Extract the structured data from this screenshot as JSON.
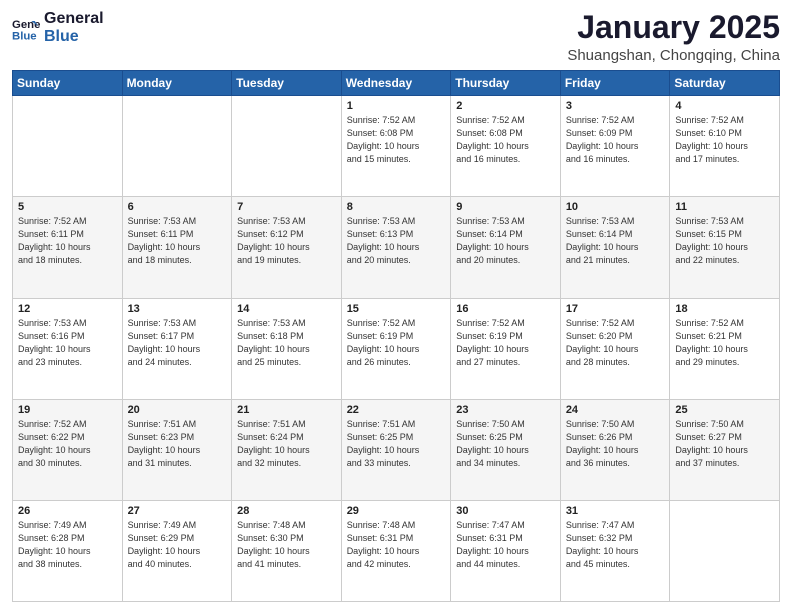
{
  "logo": {
    "line1": "General",
    "line2": "Blue"
  },
  "title": "January 2025",
  "subtitle": "Shuangshan, Chongqing, China",
  "days_header": [
    "Sunday",
    "Monday",
    "Tuesday",
    "Wednesday",
    "Thursday",
    "Friday",
    "Saturday"
  ],
  "weeks": [
    [
      {
        "day": "",
        "info": ""
      },
      {
        "day": "",
        "info": ""
      },
      {
        "day": "",
        "info": ""
      },
      {
        "day": "1",
        "info": "Sunrise: 7:52 AM\nSunset: 6:08 PM\nDaylight: 10 hours\nand 15 minutes."
      },
      {
        "day": "2",
        "info": "Sunrise: 7:52 AM\nSunset: 6:08 PM\nDaylight: 10 hours\nand 16 minutes."
      },
      {
        "day": "3",
        "info": "Sunrise: 7:52 AM\nSunset: 6:09 PM\nDaylight: 10 hours\nand 16 minutes."
      },
      {
        "day": "4",
        "info": "Sunrise: 7:52 AM\nSunset: 6:10 PM\nDaylight: 10 hours\nand 17 minutes."
      }
    ],
    [
      {
        "day": "5",
        "info": "Sunrise: 7:52 AM\nSunset: 6:11 PM\nDaylight: 10 hours\nand 18 minutes."
      },
      {
        "day": "6",
        "info": "Sunrise: 7:53 AM\nSunset: 6:11 PM\nDaylight: 10 hours\nand 18 minutes."
      },
      {
        "day": "7",
        "info": "Sunrise: 7:53 AM\nSunset: 6:12 PM\nDaylight: 10 hours\nand 19 minutes."
      },
      {
        "day": "8",
        "info": "Sunrise: 7:53 AM\nSunset: 6:13 PM\nDaylight: 10 hours\nand 20 minutes."
      },
      {
        "day": "9",
        "info": "Sunrise: 7:53 AM\nSunset: 6:14 PM\nDaylight: 10 hours\nand 20 minutes."
      },
      {
        "day": "10",
        "info": "Sunrise: 7:53 AM\nSunset: 6:14 PM\nDaylight: 10 hours\nand 21 minutes."
      },
      {
        "day": "11",
        "info": "Sunrise: 7:53 AM\nSunset: 6:15 PM\nDaylight: 10 hours\nand 22 minutes."
      }
    ],
    [
      {
        "day": "12",
        "info": "Sunrise: 7:53 AM\nSunset: 6:16 PM\nDaylight: 10 hours\nand 23 minutes."
      },
      {
        "day": "13",
        "info": "Sunrise: 7:53 AM\nSunset: 6:17 PM\nDaylight: 10 hours\nand 24 minutes."
      },
      {
        "day": "14",
        "info": "Sunrise: 7:53 AM\nSunset: 6:18 PM\nDaylight: 10 hours\nand 25 minutes."
      },
      {
        "day": "15",
        "info": "Sunrise: 7:52 AM\nSunset: 6:19 PM\nDaylight: 10 hours\nand 26 minutes."
      },
      {
        "day": "16",
        "info": "Sunrise: 7:52 AM\nSunset: 6:19 PM\nDaylight: 10 hours\nand 27 minutes."
      },
      {
        "day": "17",
        "info": "Sunrise: 7:52 AM\nSunset: 6:20 PM\nDaylight: 10 hours\nand 28 minutes."
      },
      {
        "day": "18",
        "info": "Sunrise: 7:52 AM\nSunset: 6:21 PM\nDaylight: 10 hours\nand 29 minutes."
      }
    ],
    [
      {
        "day": "19",
        "info": "Sunrise: 7:52 AM\nSunset: 6:22 PM\nDaylight: 10 hours\nand 30 minutes."
      },
      {
        "day": "20",
        "info": "Sunrise: 7:51 AM\nSunset: 6:23 PM\nDaylight: 10 hours\nand 31 minutes."
      },
      {
        "day": "21",
        "info": "Sunrise: 7:51 AM\nSunset: 6:24 PM\nDaylight: 10 hours\nand 32 minutes."
      },
      {
        "day": "22",
        "info": "Sunrise: 7:51 AM\nSunset: 6:25 PM\nDaylight: 10 hours\nand 33 minutes."
      },
      {
        "day": "23",
        "info": "Sunrise: 7:50 AM\nSunset: 6:25 PM\nDaylight: 10 hours\nand 34 minutes."
      },
      {
        "day": "24",
        "info": "Sunrise: 7:50 AM\nSunset: 6:26 PM\nDaylight: 10 hours\nand 36 minutes."
      },
      {
        "day": "25",
        "info": "Sunrise: 7:50 AM\nSunset: 6:27 PM\nDaylight: 10 hours\nand 37 minutes."
      }
    ],
    [
      {
        "day": "26",
        "info": "Sunrise: 7:49 AM\nSunset: 6:28 PM\nDaylight: 10 hours\nand 38 minutes."
      },
      {
        "day": "27",
        "info": "Sunrise: 7:49 AM\nSunset: 6:29 PM\nDaylight: 10 hours\nand 40 minutes."
      },
      {
        "day": "28",
        "info": "Sunrise: 7:48 AM\nSunset: 6:30 PM\nDaylight: 10 hours\nand 41 minutes."
      },
      {
        "day": "29",
        "info": "Sunrise: 7:48 AM\nSunset: 6:31 PM\nDaylight: 10 hours\nand 42 minutes."
      },
      {
        "day": "30",
        "info": "Sunrise: 7:47 AM\nSunset: 6:31 PM\nDaylight: 10 hours\nand 44 minutes."
      },
      {
        "day": "31",
        "info": "Sunrise: 7:47 AM\nSunset: 6:32 PM\nDaylight: 10 hours\nand 45 minutes."
      },
      {
        "day": "",
        "info": ""
      }
    ]
  ]
}
